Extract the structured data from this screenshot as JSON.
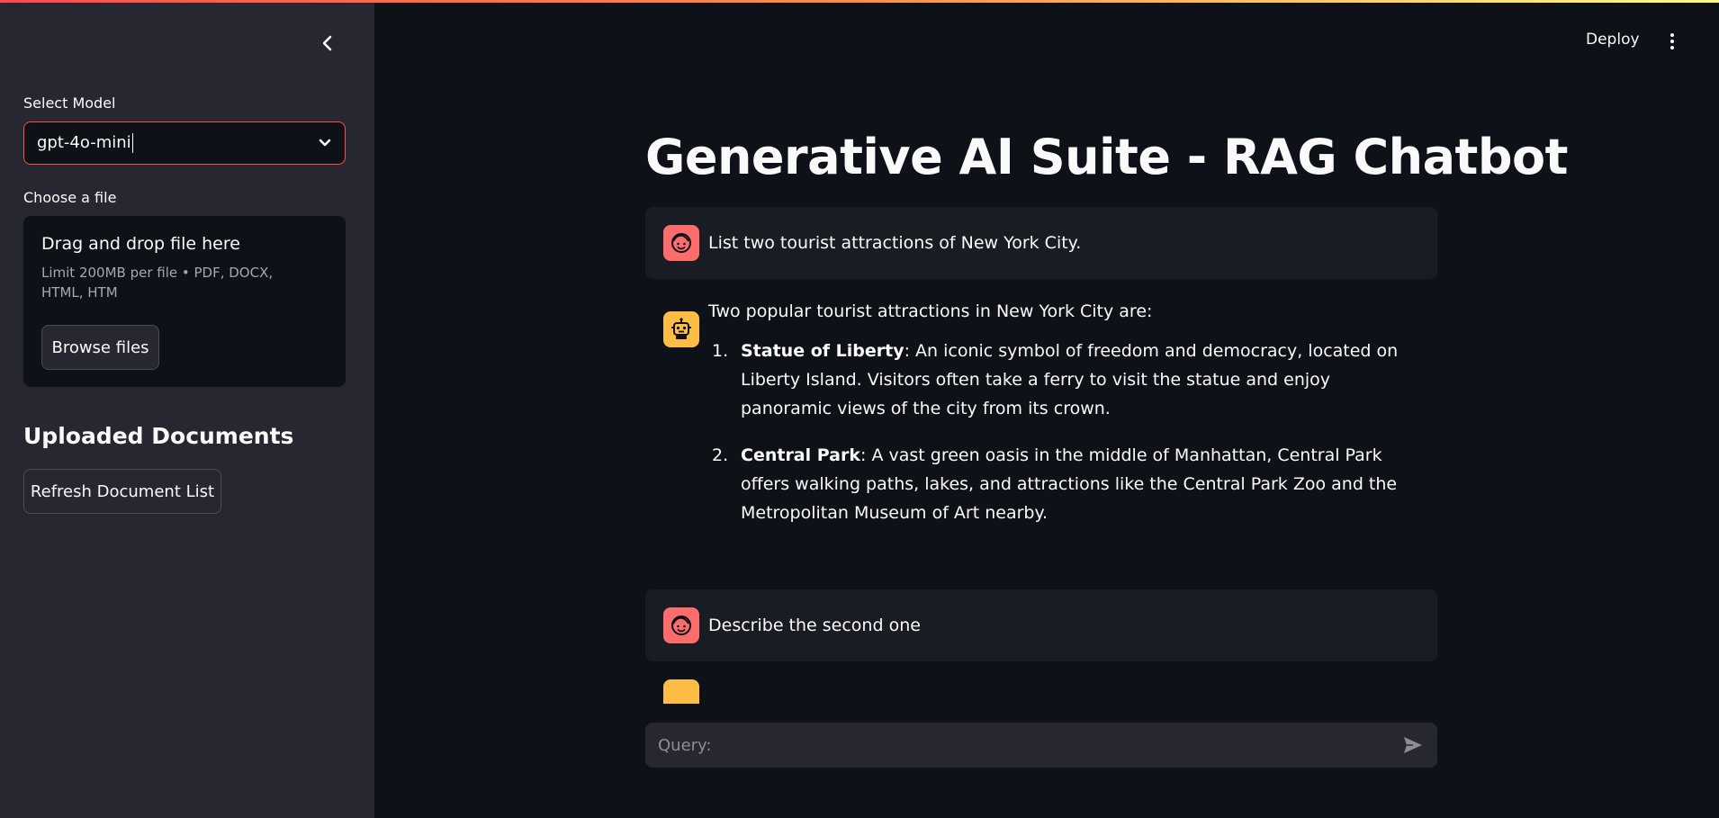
{
  "colors": {
    "accent": "#ff4b4b",
    "app_bg": "#0e1117",
    "sidebar_bg": "#262730",
    "user_avatar": "#ff6c6c",
    "bot_avatar": "#ffbd45"
  },
  "sidebar": {
    "collapse_icon": "chevron-left-icon",
    "model_label": "Select Model",
    "model_value": "gpt-4o-mini",
    "file_label": "Choose a file",
    "uploader": {
      "title": "Drag and drop file here",
      "limit": "Limit 200MB per file • PDF, DOCX, HTML, HTM",
      "browse_label": "Browse files"
    },
    "docs_heading": "Uploaded Documents",
    "refresh_label": "Refresh Document List"
  },
  "header": {
    "deploy_label": "Deploy",
    "menu_icon": "kebab-menu-icon"
  },
  "main": {
    "title": "Generative AI Suite - RAG Chatbot",
    "messages": [
      {
        "role": "user",
        "text": "List two tourist attractions of New York City."
      },
      {
        "role": "assistant",
        "intro": "Two popular tourist attractions in New York City are:",
        "items": [
          {
            "num": "1.",
            "name": "Statue of Liberty",
            "desc": ": An iconic symbol of freedom and democracy, located on Liberty Island. Visitors often take a ferry to visit the statue and enjoy panoramic views of the city from its crown."
          },
          {
            "num": "2.",
            "name": "Central Park",
            "desc": ": A vast green oasis in the middle of Manhattan, Central Park offers walking paths, lakes, and attractions like the Central Park Zoo and the Metropolitan Museum of Art nearby."
          }
        ]
      },
      {
        "role": "user",
        "text": "Describe the second one"
      },
      {
        "role": "assistant",
        "text": ""
      }
    ],
    "query_placeholder": "Query:"
  }
}
